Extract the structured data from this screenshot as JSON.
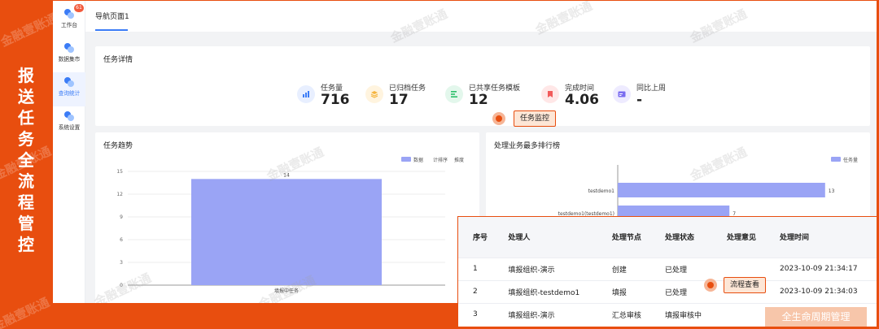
{
  "banner": {
    "text": "报送任务全流程管控"
  },
  "sidebar": {
    "badge": "61",
    "items": [
      {
        "label": "工作台"
      },
      {
        "label": "数据集市"
      },
      {
        "label": "查询统计"
      },
      {
        "label": "系统设置"
      }
    ]
  },
  "topnav": {
    "tab": "导航页面1"
  },
  "task_detail": {
    "title": "任务详情",
    "stats": [
      {
        "label": "任务量",
        "value": "716",
        "icon": "bar-chart-icon",
        "color": "#3b7cf6"
      },
      {
        "label": "已归档任务",
        "value": "17",
        "icon": "layers-icon",
        "color": "#f5b53f"
      },
      {
        "label": "已共享任务模板",
        "value": "12",
        "icon": "list-icon",
        "color": "#2bbf6a"
      },
      {
        "label": "完成时间",
        "value": "4.06",
        "icon": "bookmark-icon",
        "color": "#f25a5a"
      },
      {
        "label": "同比上周",
        "value": "-",
        "icon": "card-icon",
        "color": "#7a6cf0"
      }
    ],
    "callout": "任务监控"
  },
  "trend_chart": {
    "title": "任务趋势",
    "legend": [
      "数据",
      "计排序",
      "推度"
    ]
  },
  "ranking_chart": {
    "title": "处理业务最多排行榜",
    "legend": [
      "任务量"
    ]
  },
  "chart_data": [
    {
      "type": "bar",
      "title": "任务趋势",
      "categories": [
        "填报中任务"
      ],
      "values": [
        14
      ],
      "ylim": [
        0,
        15
      ],
      "yticks": [
        0,
        3,
        6,
        9,
        12,
        15
      ],
      "grid": true,
      "legend_placement": "top-right"
    },
    {
      "type": "bar",
      "orientation": "horizontal",
      "title": "处理业务最多排行榜",
      "categories": [
        "testdemo1",
        "testdemo1(testdemo1)"
      ],
      "values": [
        13,
        7
      ],
      "grid": true,
      "legend_placement": "top-right"
    }
  ],
  "process_table": {
    "headers": [
      "序号",
      "处理人",
      "处理节点",
      "处理状态",
      "处理意见",
      "处理时间"
    ],
    "rows": [
      [
        "1",
        "填报组织-演示",
        "创建",
        "已处理",
        "",
        "2023-10-09 21:34:17"
      ],
      [
        "2",
        "填报组织-testdemo1",
        "填报",
        "已处理",
        "",
        "2023-10-09 21:34:03"
      ],
      [
        "3",
        "填报组织-演示",
        "汇总审核",
        "填报审核中",
        "",
        ""
      ]
    ],
    "callout": "流程查看"
  },
  "lifecycle_label": "全生命周期管理",
  "watermark": "金融壹账通",
  "colors": {
    "accent": "#e84e0f",
    "primary": "#3b7cf6",
    "bar": "#9aa4f5"
  }
}
